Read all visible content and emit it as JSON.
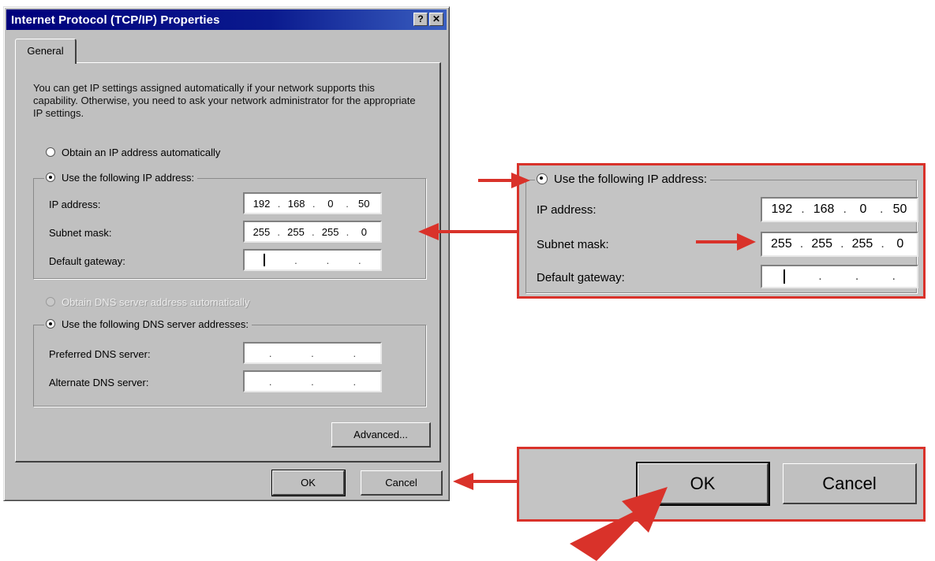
{
  "dialog": {
    "title": "Internet Protocol (TCP/IP) Properties",
    "help_label": "?",
    "close_label": "✕",
    "tab_general": "General",
    "intro": "You can get IP settings assigned automatically if your network supports this capability. Otherwise, you need to ask your network administrator for the appropriate IP settings.",
    "ip_auto_label": "Obtain an IP address automatically",
    "ip_manual_label": "Use the following IP address:",
    "ip_address_label": "IP address:",
    "subnet_label": "Subnet mask:",
    "gateway_label": "Default gateway:",
    "ip_address": [
      "192",
      "168",
      "0",
      "50"
    ],
    "subnet": [
      "255",
      "255",
      "255",
      "0"
    ],
    "dns_auto_label": "Obtain DNS server address automatically",
    "dns_manual_label": "Use the following DNS server addresses:",
    "preferred_dns_label": "Preferred DNS server:",
    "alternate_dns_label": "Alternate DNS server:",
    "advanced_label": "Advanced...",
    "ok_label": "OK",
    "cancel_label": "Cancel"
  },
  "colors": {
    "accent_red": "#d9322a",
    "title_blue": "#00007c",
    "dialog_gray": "#c0c0c0"
  }
}
